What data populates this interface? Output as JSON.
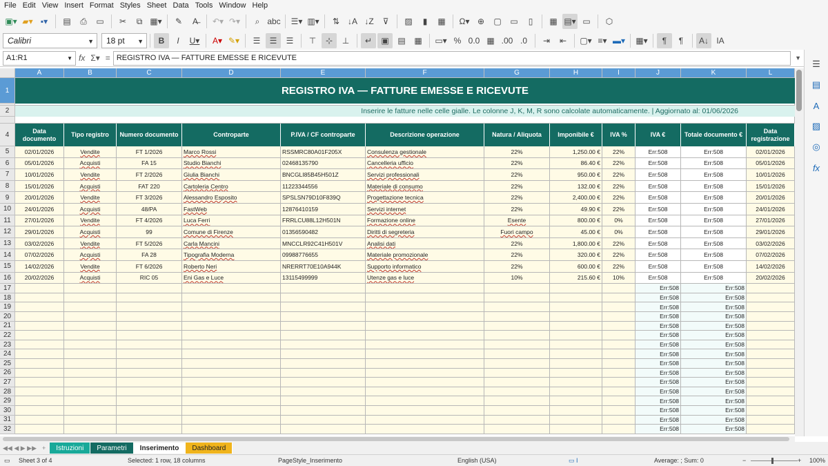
{
  "menu": [
    "File",
    "Edit",
    "View",
    "Insert",
    "Format",
    "Styles",
    "Sheet",
    "Data",
    "Tools",
    "Window",
    "Help"
  ],
  "toolbar": {
    "font_name": "Calibri",
    "font_size": "18 pt"
  },
  "formula_bar": {
    "name_box": "A1:R1",
    "formula": "REGISTRO IVA — FATTURE EMESSE E RICEVUTE"
  },
  "columns": [
    "A",
    "B",
    "C",
    "D",
    "E",
    "F",
    "G",
    "H",
    "I",
    "J",
    "K",
    "L"
  ],
  "title": "REGISTRO IVA — FATTURE EMESSE E RICEVUTE",
  "subtitle": "Inserire le fatture nelle celle gialle. Le colonne J, K, M, R sono calcolate automaticamente. | Aggiornato al: 01/06/2026",
  "headers": [
    "Data documento",
    "Tipo registro",
    "Numero documento",
    "Controparte",
    "P.IVA / CF controparte",
    "Descrizione operazione",
    "Natura / Aliquota",
    "Imponibile €",
    "IVA %",
    "IVA €",
    "Totale documento €",
    "Data registrazione"
  ],
  "rows": [
    [
      "02/01/2026",
      "Vendite",
      "FT 1/2026",
      "Marco Rossi",
      "RSSMRC80A01F205X",
      "Consulenza gestionale",
      "22%",
      "1,250.00 €",
      "22%",
      "Err:508",
      "Err:508",
      "02/01/2026"
    ],
    [
      "05/01/2026",
      "Acquisti",
      "FA 15",
      "Studio Bianchi",
      "02468135790",
      "Cancelleria ufficio",
      "22%",
      "86.40 €",
      "22%",
      "Err:508",
      "Err:508",
      "05/01/2026"
    ],
    [
      "10/01/2026",
      "Vendite",
      "FT 2/2026",
      "Giulia Bianchi",
      "BNCGLI85B45H501Z",
      "Servizi professionali",
      "22%",
      "950.00 €",
      "22%",
      "Err:508",
      "Err:508",
      "10/01/2026"
    ],
    [
      "15/01/2026",
      "Acquisti",
      "FAT 220",
      "Cartoleria Centro",
      "11223344556",
      "Materiale di consumo",
      "22%",
      "132.00 €",
      "22%",
      "Err:508",
      "Err:508",
      "15/01/2026"
    ],
    [
      "20/01/2026",
      "Vendite",
      "FT 3/2026",
      "Alessandro Esposito",
      "SPSLSN79D10F839Q",
      "Progettazione tecnica",
      "22%",
      "2,400.00 €",
      "22%",
      "Err:508",
      "Err:508",
      "20/01/2026"
    ],
    [
      "24/01/2026",
      "Acquisti",
      "48/PA",
      "FastWeb",
      "12876410159",
      "Servizi internet",
      "22%",
      "49.90 €",
      "22%",
      "Err:508",
      "Err:508",
      "24/01/2026"
    ],
    [
      "27/01/2026",
      "Vendite",
      "FT 4/2026",
      "Luca Ferri",
      "FRRLCU88L12H501N",
      "Formazione online",
      "Esente",
      "800.00 €",
      "0%",
      "Err:508",
      "Err:508",
      "27/01/2026"
    ],
    [
      "29/01/2026",
      "Acquisti",
      "99",
      "Comune di Firenze",
      "01356590482",
      "Diritti di segreteria",
      "Fuori campo",
      "45.00 €",
      "0%",
      "Err:508",
      "Err:508",
      "29/01/2026"
    ],
    [
      "03/02/2026",
      "Vendite",
      "FT 5/2026",
      "Carla Mancini",
      "MNCCLR92C41H501V",
      "Analisi dati",
      "22%",
      "1,800.00 €",
      "22%",
      "Err:508",
      "Err:508",
      "03/02/2026"
    ],
    [
      "07/02/2026",
      "Acquisti",
      "FA 28",
      "Tipografia Moderna",
      "09988776655",
      "Materiale promozionale",
      "22%",
      "320.00 €",
      "22%",
      "Err:508",
      "Err:508",
      "07/02/2026"
    ],
    [
      "14/02/2026",
      "Vendite",
      "FT 6/2026",
      "Roberto Neri",
      "NRERRT70E10A944K",
      "Supporto informatico",
      "22%",
      "600.00 €",
      "22%",
      "Err:508",
      "Err:508",
      "14/02/2026"
    ],
    [
      "20/02/2026",
      "Acquisti",
      "RIC 05",
      "Eni Gas e Luce",
      "13115499999",
      "Utenze gas e luce",
      "10%",
      "215.60 €",
      "10%",
      "Err:508",
      "Err:508",
      "20/02/2026"
    ]
  ],
  "empty_err": "Err:508",
  "empty_row_numbers": [
    "17",
    "18",
    "19",
    "20",
    "21",
    "22",
    "23",
    "24",
    "25",
    "26",
    "27",
    "28",
    "29",
    "30",
    "31",
    "32"
  ],
  "sheet_tabs": [
    {
      "label": "Istruzioni",
      "color": "#18a999"
    },
    {
      "label": "Parametri",
      "color": "#146b62"
    },
    {
      "label": "Inserimento",
      "color": "#ffffff"
    },
    {
      "label": "Dashboard",
      "color": "#f0b41c"
    }
  ],
  "status": {
    "sheet": "Sheet 3 of 4",
    "selection": "Selected: 1 row, 18 columns",
    "page_style": "PageStyle_Inserimento",
    "language": "English (USA)",
    "sum": "Average: ; Sum: 0",
    "zoom": "100%"
  }
}
